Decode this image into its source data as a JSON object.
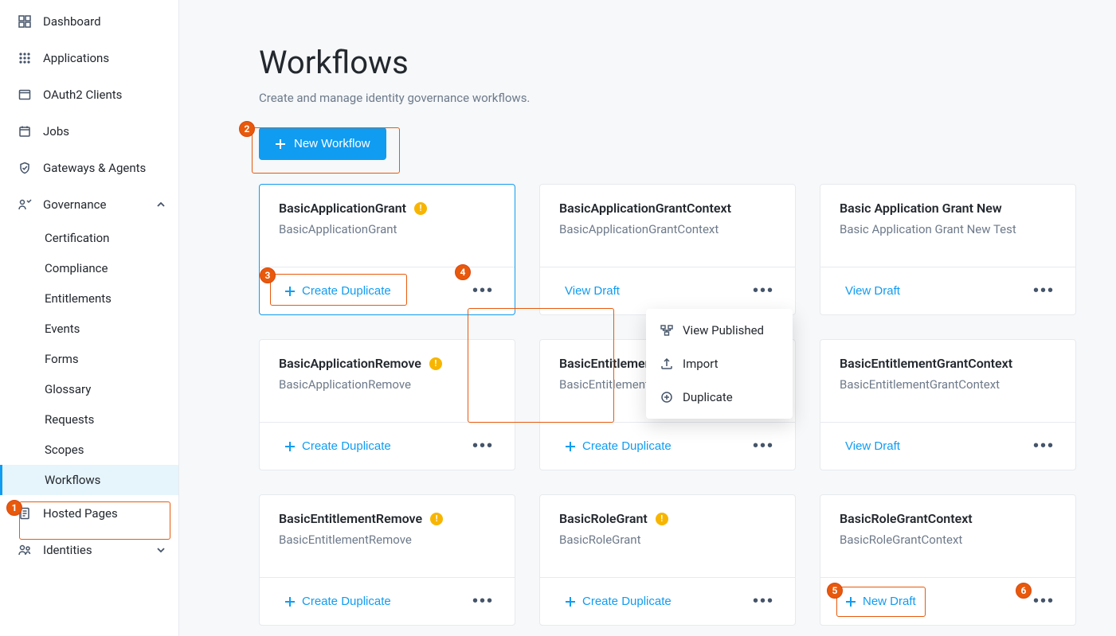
{
  "sidebar": {
    "items": [
      {
        "label": "Dashboard"
      },
      {
        "label": "Applications"
      },
      {
        "label": "OAuth2 Clients"
      },
      {
        "label": "Jobs"
      },
      {
        "label": "Gateways & Agents"
      },
      {
        "label": "Governance"
      },
      {
        "label": "Hosted Pages"
      },
      {
        "label": "Identities"
      }
    ],
    "governance_children": [
      {
        "label": "Certification"
      },
      {
        "label": "Compliance"
      },
      {
        "label": "Entitlements"
      },
      {
        "label": "Events"
      },
      {
        "label": "Forms"
      },
      {
        "label": "Glossary"
      },
      {
        "label": "Requests"
      },
      {
        "label": "Scopes"
      },
      {
        "label": "Workflows"
      }
    ]
  },
  "page": {
    "title": "Workflows",
    "subtitle": "Create and manage identity governance workflows.",
    "new_button": "New Workflow"
  },
  "actions": {
    "create_duplicate": "Create Duplicate",
    "view_draft": "View Draft",
    "new_draft": "New Draft"
  },
  "menu": {
    "view_published": "View Published",
    "import": "Import",
    "duplicate": "Duplicate"
  },
  "cards": [
    {
      "title": "BasicApplicationGrant",
      "sub": "BasicApplicationGrant",
      "warn": true,
      "primary": "create_duplicate",
      "selected": true
    },
    {
      "title": "BasicApplicationGrantContext",
      "sub": "BasicApplicationGrantContext",
      "warn": false,
      "primary": "view_draft"
    },
    {
      "title": "Basic Application Grant New",
      "sub": "Basic Application Grant New Test",
      "warn": false,
      "primary": "view_draft"
    },
    {
      "title": "BasicApplicationRemove",
      "sub": "BasicApplicationRemove",
      "warn": true,
      "primary": "create_duplicate"
    },
    {
      "title": "BasicEntitlementGrant",
      "sub": "BasicEntitlementGrant",
      "warn": true,
      "primary": "create_duplicate"
    },
    {
      "title": "BasicEntitlementGrantContext",
      "sub": "BasicEntitlementGrantContext",
      "warn": false,
      "primary": "view_draft"
    },
    {
      "title": "BasicEntitlementRemove",
      "sub": "BasicEntitlementRemove",
      "warn": true,
      "primary": "create_duplicate"
    },
    {
      "title": "BasicRoleGrant",
      "sub": "BasicRoleGrant",
      "warn": true,
      "primary": "create_duplicate"
    },
    {
      "title": "BasicRoleGrantContext",
      "sub": "BasicRoleGrantContext",
      "warn": false,
      "primary": "new_draft"
    }
  ],
  "annotations": [
    "1",
    "2",
    "3",
    "4",
    "5",
    "6"
  ]
}
